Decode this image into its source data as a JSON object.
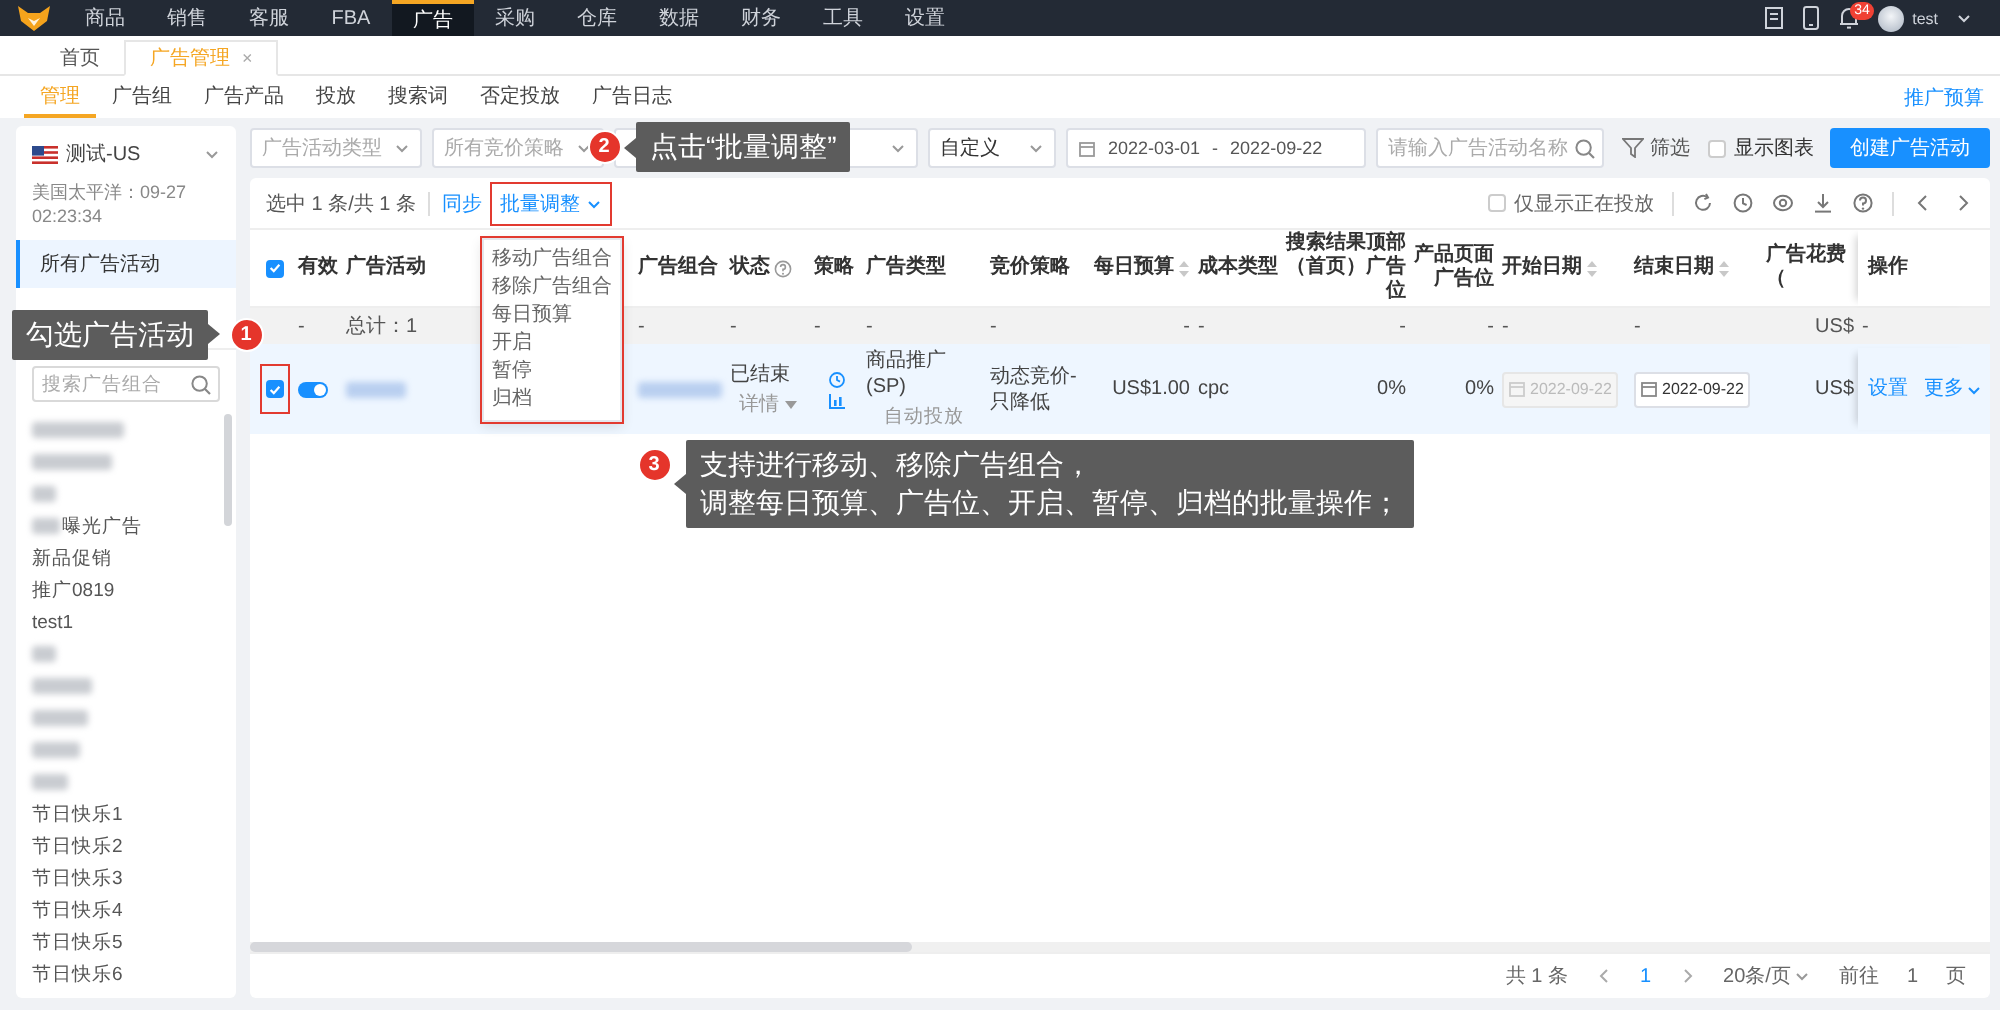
{
  "top_nav": {
    "items": [
      {
        "label": "商品",
        "selected": false
      },
      {
        "label": "销售",
        "selected": false
      },
      {
        "label": "客服",
        "selected": false
      },
      {
        "label": "FBA",
        "selected": false
      },
      {
        "label": "广告",
        "selected": true
      },
      {
        "label": "采购",
        "selected": false
      },
      {
        "label": "仓库",
        "selected": false
      },
      {
        "label": "数据",
        "selected": false
      },
      {
        "label": "财务",
        "selected": false
      },
      {
        "label": "工具",
        "selected": false
      },
      {
        "label": "设置",
        "selected": false
      }
    ],
    "notification_count": "34",
    "user": "test"
  },
  "page_tabs": [
    {
      "label": "首页",
      "selected": false
    },
    {
      "label": "广告管理",
      "selected": true,
      "close": "×"
    }
  ],
  "sub_nav": {
    "items": [
      {
        "label": "管理",
        "selected": true
      },
      {
        "label": "广告组",
        "selected": false
      },
      {
        "label": "广告产品",
        "selected": false
      },
      {
        "label": "投放",
        "selected": false
      },
      {
        "label": "搜索词",
        "selected": false
      },
      {
        "label": "否定投放",
        "selected": false
      },
      {
        "label": "广告日志",
        "selected": false
      }
    ],
    "budget_link": "推广预算"
  },
  "filters": {
    "selects": [
      {
        "kind": "placeholder",
        "text": "广告活动类型"
      },
      {
        "kind": "placeholder",
        "text": "所有竞价策略"
      },
      {
        "kind": "covered"
      },
      {
        "kind": "value",
        "text": "自定义"
      }
    ],
    "date_start": "2022-03-01",
    "date_separator": "-",
    "date_end": "2022-09-22",
    "search_placeholder": "请输入广告活动名称",
    "filter_button": "筛选",
    "show_chart": {
      "label": "显示图表",
      "checked": false
    },
    "create_button": "创建广告活动"
  },
  "sidebar": {
    "store": "测试-US",
    "timezone": "美国太平洋：09-27 02:23:34",
    "nav": [
      {
        "label": "所有广告活动",
        "selected": true
      }
    ],
    "search_placeholder": "搜索广告组合",
    "items": [
      {
        "kind": "blurred"
      },
      {
        "kind": "blurred"
      },
      {
        "kind": "blurred"
      },
      {
        "kind": "partial",
        "label": "曝光广告"
      },
      {
        "kind": "text",
        "label": "新品促销"
      },
      {
        "kind": "text",
        "label": "推广0819"
      },
      {
        "kind": "text",
        "label": "test1"
      },
      {
        "kind": "blurred"
      },
      {
        "kind": "blurred"
      },
      {
        "kind": "blurred"
      },
      {
        "kind": "blurred"
      },
      {
        "kind": "blurred"
      },
      {
        "kind": "text",
        "label": "节日快乐1"
      },
      {
        "kind": "text",
        "label": "节日快乐2"
      },
      {
        "kind": "text",
        "label": "节日快乐3"
      },
      {
        "kind": "text",
        "label": "节日快乐4"
      },
      {
        "kind": "text",
        "label": "节日快乐5"
      },
      {
        "kind": "text",
        "label": "节日快乐6"
      }
    ]
  },
  "toolbar": {
    "selection": "选中 1 条/共 1 条",
    "sync": "同步",
    "batch": "批量调整",
    "only_active": {
      "label": "仅显示正在投放",
      "checked": false
    }
  },
  "batch_menu": {
    "open": true,
    "items": [
      "移动广告组合",
      "移除广告组合",
      "每日预算",
      "开启",
      "暂停",
      "归档"
    ]
  },
  "table": {
    "all_checked": true,
    "columns": [
      {
        "label": "有效"
      },
      {
        "label": "广告活动"
      },
      {
        "label": "广告组合"
      },
      {
        "label": "状态",
        "help": true
      },
      {
        "label": "策略"
      },
      {
        "label": "广告类型"
      },
      {
        "label": "竞价策略"
      },
      {
        "label": "每日预算",
        "sortable": true
      },
      {
        "label": "成本类型"
      },
      {
        "label": "搜索结果顶部（首页）广告位"
      },
      {
        "label": "产品页面广告位"
      },
      {
        "label": "开始日期",
        "sortable": true
      },
      {
        "label": "结束日期",
        "sortable": true
      },
      {
        "label": "广告花费（"
      },
      {
        "label": "操作"
      }
    ],
    "total_row": [
      "-",
      "总计：1",
      "-",
      "-",
      "-",
      "-",
      "-",
      "-",
      "-",
      "-",
      "-",
      "-",
      "-",
      "US$",
      "-"
    ],
    "rows": [
      {
        "checked": true,
        "enabled": true,
        "campaign": {
          "kind": "blurred"
        },
        "group": {
          "kind": "blurred"
        },
        "status": "已结束",
        "status_detail": "详情",
        "ad_type": "商品推广(SP)",
        "targeting": "自动投放",
        "bid_strategy": "动态竞价-只降低",
        "daily_budget": "US$1.00",
        "cost_type": "cpc",
        "top_of_search": "0%",
        "product_page": "0%",
        "start_date": "2022-09-22",
        "start_disabled": true,
        "end_date": "2022-09-22",
        "spend": "US$",
        "actions": [
          "设置",
          "更多"
        ]
      }
    ]
  },
  "pagination": {
    "total": "共 1 条",
    "pages": [
      {
        "label": "1",
        "selected": true
      }
    ],
    "page_size": "20条/页",
    "goto_label": "前往",
    "goto_value": "1",
    "page_unit": "页"
  },
  "callouts": [
    {
      "number": "1",
      "text": "勾选广告活动"
    },
    {
      "number": "2",
      "text": "点击“批量调整”"
    },
    {
      "number": "3",
      "lines": [
        "支持进行移动、移除广告组合，",
        "调整每日预算、广告位、开启、暂停、归档的批量操作；"
      ]
    }
  ]
}
